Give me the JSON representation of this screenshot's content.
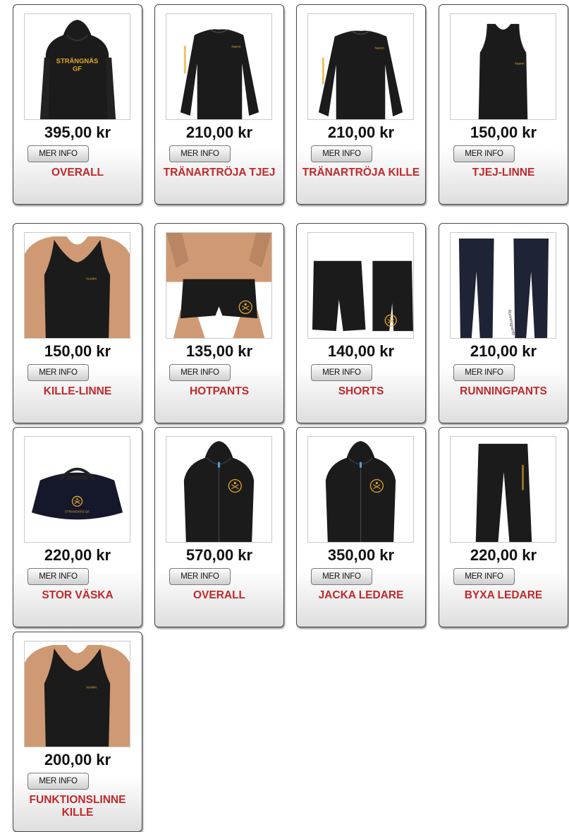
{
  "products": [
    {
      "price": "395,00 kr",
      "button": "MER INFO",
      "name": "OVERALL",
      "image": "hoodie-back-print",
      "print_text": "STRÄNGNÄS GF"
    },
    {
      "price": "210,00 kr",
      "button": "MER INFO",
      "name": "TRÄNARTRÖJA TJEJ",
      "image": "long-sleeve-women"
    },
    {
      "price": "210,00 kr",
      "button": "MER INFO",
      "name": "TRÄNARTRÖJA KILLE",
      "image": "long-sleeve-men"
    },
    {
      "price": "150,00 kr",
      "button": "MER INFO",
      "name": "TJEJ-LINNE",
      "image": "tank-top-women"
    },
    {
      "price": "150,00 kr",
      "button": "MER INFO",
      "name": "KILLE-LINNE",
      "image": "tank-top-men"
    },
    {
      "price": "135,00 kr",
      "button": "MER INFO",
      "name": "HOTPANTS",
      "image": "hotpants"
    },
    {
      "price": "140,00 kr",
      "button": "MER INFO",
      "name": "SHORTS",
      "image": "shorts"
    },
    {
      "price": "210,00 kr",
      "button": "MER INFO",
      "name": "RUNNINGPANTS",
      "image": "running-tights"
    },
    {
      "price": "220,00 kr",
      "button": "MER INFO",
      "name": "STOR VÄSKA",
      "image": "duffel-bag",
      "print_text": "STRÄNGNÄS GF"
    },
    {
      "price": "570,00 kr",
      "button": "MER INFO",
      "name": "OVERALL",
      "image": "zip-hoodie"
    },
    {
      "price": "350,00 kr",
      "button": "MER INFO",
      "name": "JACKA LEDARE",
      "image": "zip-hoodie"
    },
    {
      "price": "220,00 kr",
      "button": "MER INFO",
      "name": "BYXA LEDARE",
      "image": "track-pants"
    },
    {
      "price": "200,00 kr",
      "button": "MER INFO",
      "name": "FUNKTIONSLINNE KILLE",
      "image": "tank-top-men"
    }
  ],
  "colors": {
    "name": "#c0292c",
    "print": "#e3a92a",
    "garment": "#1a1a1a"
  }
}
